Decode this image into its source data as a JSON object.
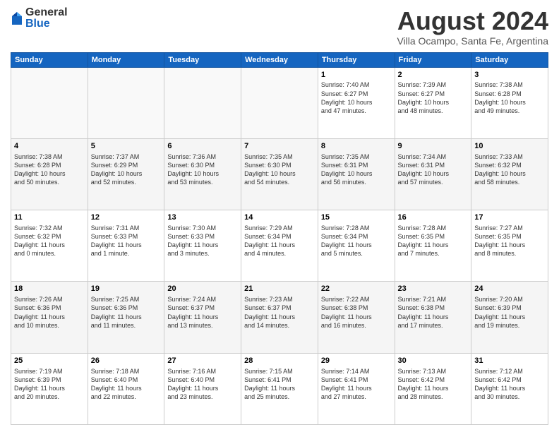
{
  "logo": {
    "general": "General",
    "blue": "Blue"
  },
  "header": {
    "month_year": "August 2024",
    "location": "Villa Ocampo, Santa Fe, Argentina"
  },
  "days_of_week": [
    "Sunday",
    "Monday",
    "Tuesday",
    "Wednesday",
    "Thursday",
    "Friday",
    "Saturday"
  ],
  "weeks": [
    [
      {
        "day": "",
        "detail": ""
      },
      {
        "day": "",
        "detail": ""
      },
      {
        "day": "",
        "detail": ""
      },
      {
        "day": "",
        "detail": ""
      },
      {
        "day": "1",
        "detail": "Sunrise: 7:40 AM\nSunset: 6:27 PM\nDaylight: 10 hours\nand 47 minutes."
      },
      {
        "day": "2",
        "detail": "Sunrise: 7:39 AM\nSunset: 6:27 PM\nDaylight: 10 hours\nand 48 minutes."
      },
      {
        "day": "3",
        "detail": "Sunrise: 7:38 AM\nSunset: 6:28 PM\nDaylight: 10 hours\nand 49 minutes."
      }
    ],
    [
      {
        "day": "4",
        "detail": "Sunrise: 7:38 AM\nSunset: 6:28 PM\nDaylight: 10 hours\nand 50 minutes."
      },
      {
        "day": "5",
        "detail": "Sunrise: 7:37 AM\nSunset: 6:29 PM\nDaylight: 10 hours\nand 52 minutes."
      },
      {
        "day": "6",
        "detail": "Sunrise: 7:36 AM\nSunset: 6:30 PM\nDaylight: 10 hours\nand 53 minutes."
      },
      {
        "day": "7",
        "detail": "Sunrise: 7:35 AM\nSunset: 6:30 PM\nDaylight: 10 hours\nand 54 minutes."
      },
      {
        "day": "8",
        "detail": "Sunrise: 7:35 AM\nSunset: 6:31 PM\nDaylight: 10 hours\nand 56 minutes."
      },
      {
        "day": "9",
        "detail": "Sunrise: 7:34 AM\nSunset: 6:31 PM\nDaylight: 10 hours\nand 57 minutes."
      },
      {
        "day": "10",
        "detail": "Sunrise: 7:33 AM\nSunset: 6:32 PM\nDaylight: 10 hours\nand 58 minutes."
      }
    ],
    [
      {
        "day": "11",
        "detail": "Sunrise: 7:32 AM\nSunset: 6:32 PM\nDaylight: 11 hours\nand 0 minutes."
      },
      {
        "day": "12",
        "detail": "Sunrise: 7:31 AM\nSunset: 6:33 PM\nDaylight: 11 hours\nand 1 minute."
      },
      {
        "day": "13",
        "detail": "Sunrise: 7:30 AM\nSunset: 6:33 PM\nDaylight: 11 hours\nand 3 minutes."
      },
      {
        "day": "14",
        "detail": "Sunrise: 7:29 AM\nSunset: 6:34 PM\nDaylight: 11 hours\nand 4 minutes."
      },
      {
        "day": "15",
        "detail": "Sunrise: 7:28 AM\nSunset: 6:34 PM\nDaylight: 11 hours\nand 5 minutes."
      },
      {
        "day": "16",
        "detail": "Sunrise: 7:28 AM\nSunset: 6:35 PM\nDaylight: 11 hours\nand 7 minutes."
      },
      {
        "day": "17",
        "detail": "Sunrise: 7:27 AM\nSunset: 6:35 PM\nDaylight: 11 hours\nand 8 minutes."
      }
    ],
    [
      {
        "day": "18",
        "detail": "Sunrise: 7:26 AM\nSunset: 6:36 PM\nDaylight: 11 hours\nand 10 minutes."
      },
      {
        "day": "19",
        "detail": "Sunrise: 7:25 AM\nSunset: 6:36 PM\nDaylight: 11 hours\nand 11 minutes."
      },
      {
        "day": "20",
        "detail": "Sunrise: 7:24 AM\nSunset: 6:37 PM\nDaylight: 11 hours\nand 13 minutes."
      },
      {
        "day": "21",
        "detail": "Sunrise: 7:23 AM\nSunset: 6:37 PM\nDaylight: 11 hours\nand 14 minutes."
      },
      {
        "day": "22",
        "detail": "Sunrise: 7:22 AM\nSunset: 6:38 PM\nDaylight: 11 hours\nand 16 minutes."
      },
      {
        "day": "23",
        "detail": "Sunrise: 7:21 AM\nSunset: 6:38 PM\nDaylight: 11 hours\nand 17 minutes."
      },
      {
        "day": "24",
        "detail": "Sunrise: 7:20 AM\nSunset: 6:39 PM\nDaylight: 11 hours\nand 19 minutes."
      }
    ],
    [
      {
        "day": "25",
        "detail": "Sunrise: 7:19 AM\nSunset: 6:39 PM\nDaylight: 11 hours\nand 20 minutes."
      },
      {
        "day": "26",
        "detail": "Sunrise: 7:18 AM\nSunset: 6:40 PM\nDaylight: 11 hours\nand 22 minutes."
      },
      {
        "day": "27",
        "detail": "Sunrise: 7:16 AM\nSunset: 6:40 PM\nDaylight: 11 hours\nand 23 minutes."
      },
      {
        "day": "28",
        "detail": "Sunrise: 7:15 AM\nSunset: 6:41 PM\nDaylight: 11 hours\nand 25 minutes."
      },
      {
        "day": "29",
        "detail": "Sunrise: 7:14 AM\nSunset: 6:41 PM\nDaylight: 11 hours\nand 27 minutes."
      },
      {
        "day": "30",
        "detail": "Sunrise: 7:13 AM\nSunset: 6:42 PM\nDaylight: 11 hours\nand 28 minutes."
      },
      {
        "day": "31",
        "detail": "Sunrise: 7:12 AM\nSunset: 6:42 PM\nDaylight: 11 hours\nand 30 minutes."
      }
    ]
  ]
}
